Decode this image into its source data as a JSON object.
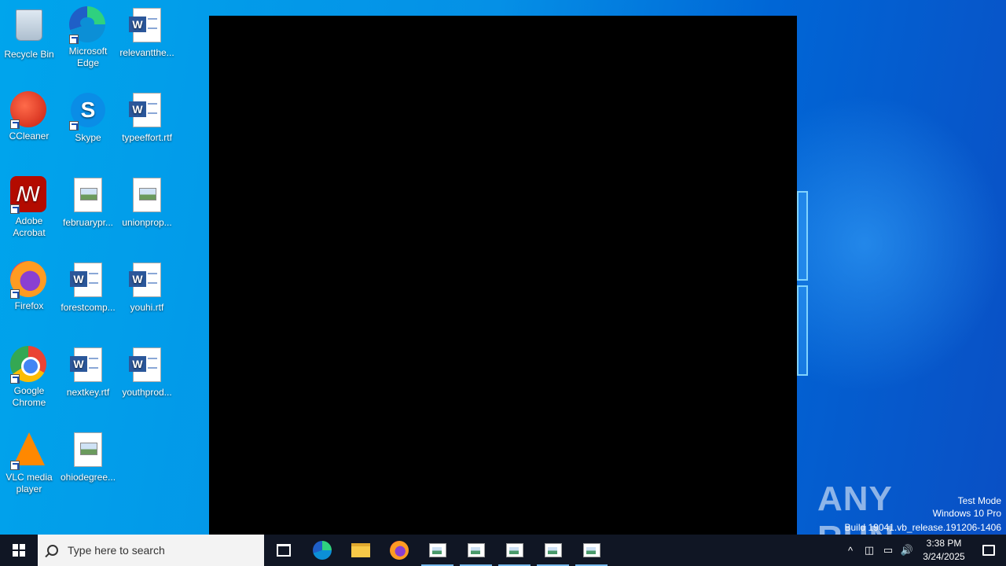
{
  "desktop": {
    "icons": [
      {
        "label": "Recycle Bin",
        "icon": "recycle-bin-icon"
      },
      {
        "label": "Microsoft Edge",
        "icon": "edge-icon"
      },
      {
        "label": "relevantthe...",
        "icon": "word-doc-icon"
      },
      {
        "label": "CCleaner",
        "icon": "ccleaner-icon"
      },
      {
        "label": "Skype",
        "icon": "skype-icon"
      },
      {
        "label": "typeeffort.rtf",
        "icon": "word-doc-icon"
      },
      {
        "label": "Adobe Acrobat",
        "icon": "acrobat-icon"
      },
      {
        "label": "februarypr...",
        "icon": "image-file-icon"
      },
      {
        "label": "unionprop...",
        "icon": "image-file-icon"
      },
      {
        "label": "Firefox",
        "icon": "firefox-icon"
      },
      {
        "label": "forestcomp...",
        "icon": "word-doc-icon"
      },
      {
        "label": "youhi.rtf",
        "icon": "word-doc-icon"
      },
      {
        "label": "Google Chrome",
        "icon": "chrome-icon"
      },
      {
        "label": "nextkey.rtf",
        "icon": "word-doc-icon"
      },
      {
        "label": "youthprod...",
        "icon": "word-doc-icon"
      },
      {
        "label": "VLC media player",
        "icon": "vlc-icon"
      },
      {
        "label": "ohiodegree...",
        "icon": "image-file-icon"
      }
    ]
  },
  "watermark": {
    "logo": "ANY RUN",
    "mode": "Test Mode",
    "edition": "Windows 10 Pro",
    "build": "Build 19041.vb_release.191206-1406"
  },
  "taskbar": {
    "search_placeholder": "Type here to search",
    "clock_time": "3:38 PM",
    "clock_date": "3/24/2025",
    "tray_overflow": "^",
    "speaker": "🔊"
  }
}
